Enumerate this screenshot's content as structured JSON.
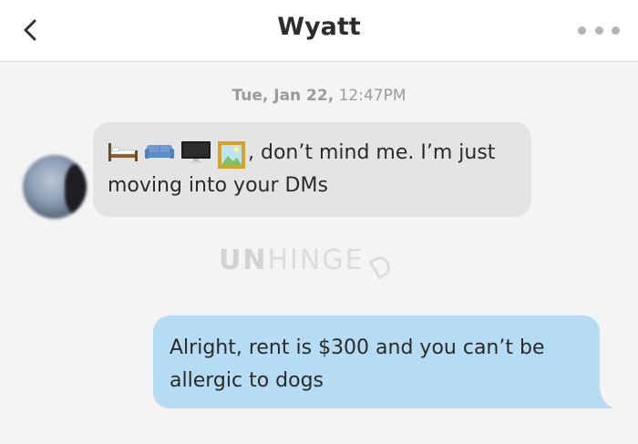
{
  "header": {
    "title": "Wyatt",
    "back_icon": "chevron-left-icon",
    "more_icon": "more-dots-icon"
  },
  "conversation": {
    "timestamp_date": "Tue, Jan 22,",
    "timestamp_time": "12:47PM",
    "incoming": {
      "sender_avatar": "avatar",
      "emoji_icons": [
        "bed-icon",
        "couch-icon",
        "computer-monitor-icon",
        "framed-picture-icon"
      ],
      "text": ", don’t mind me. I’m just moving into your DMs"
    },
    "outgoing": {
      "text": "Alright, rent is $300 and you can’t be allergic to dogs"
    }
  },
  "watermark": {
    "part_bold": "UN",
    "part_light": "HINGE",
    "part_tilted": "D"
  },
  "colors": {
    "incoming_bubble": "#e4e4e4",
    "outgoing_bubble": "#b6dcf4",
    "background": "#f4f4f4"
  }
}
